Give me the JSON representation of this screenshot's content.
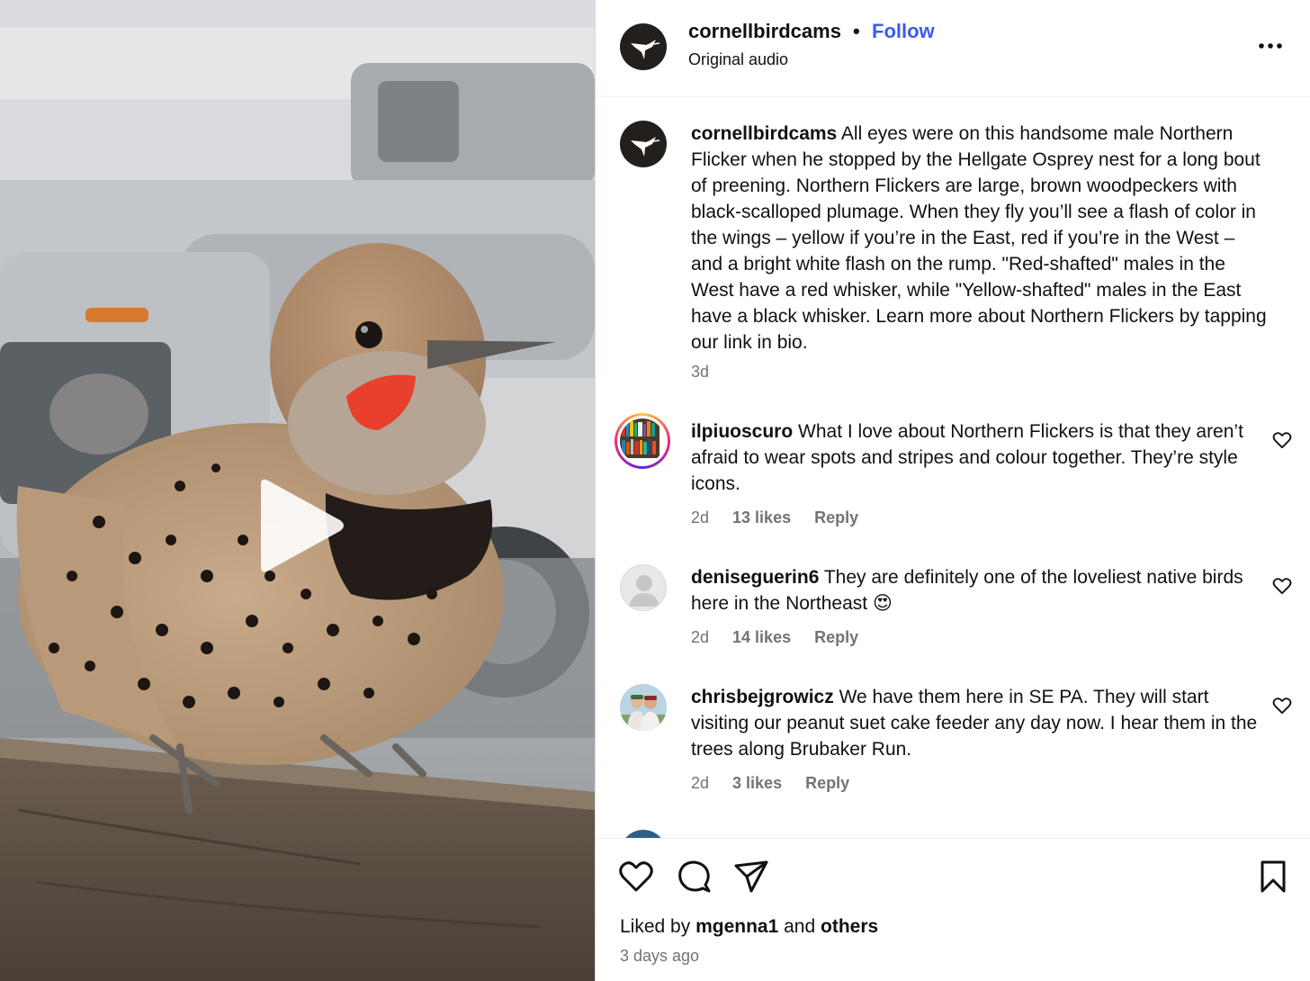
{
  "post": {
    "username": "cornellbirdcams",
    "separator": "•",
    "follow_label": "Follow",
    "audio": "Original audio",
    "caption_text": "All eyes were on this handsome male Northern Flicker when he stopped by the Hellgate Osprey nest for a long bout of preening. Northern Flickers are large, brown woodpeckers with black-scalloped plumage. When they fly you’ll see a flash of color in the wings – yellow if you’re in the East, red if you’re in the West – and a bright white flash on the rump. \"Red-shafted\" males in the West have a red whisker, while \"Yellow-shafted\" males in the East have a black whisker. Learn more about Northern Flickers by tapping our link in bio.",
    "caption_time": "3d"
  },
  "comments": [
    {
      "username": "ilpiuoscuro",
      "text": "What I love about Northern Flickers is that they aren’t afraid to wear spots and stripes and colour together. They’re style icons.",
      "time": "2d",
      "likes": "13 likes",
      "reply": "Reply"
    },
    {
      "username": "deniseguerin6",
      "text": "They are definitely one of the loveliest native birds here in the Northeast",
      "emoji": "😍",
      "time": "2d",
      "likes": "14 likes",
      "reply": "Reply"
    },
    {
      "username": "chrisbejgrowicz",
      "text": "We have them here in SE PA. They will start visiting our peanut suet cake feeder any day now. I hear them in the trees along Brubaker Run.",
      "time": "2d",
      "likes": "3 likes",
      "reply": "Reply"
    }
  ],
  "footer": {
    "liked_by_prefix": "Liked by",
    "liked_by_user": "mgenna1",
    "liked_by_and": "and",
    "liked_by_others": "others",
    "time_ago": "3 days ago"
  },
  "icons": {
    "media": "play-icon",
    "more": "more-options-icon",
    "like": "heart-icon",
    "comment": "comment-bubble-icon",
    "share": "paper-plane-icon",
    "save": "bookmark-icon"
  },
  "colors": {
    "follow": "#3b5af5",
    "meta": "#737373",
    "brand_avatar": "#231f1c"
  }
}
